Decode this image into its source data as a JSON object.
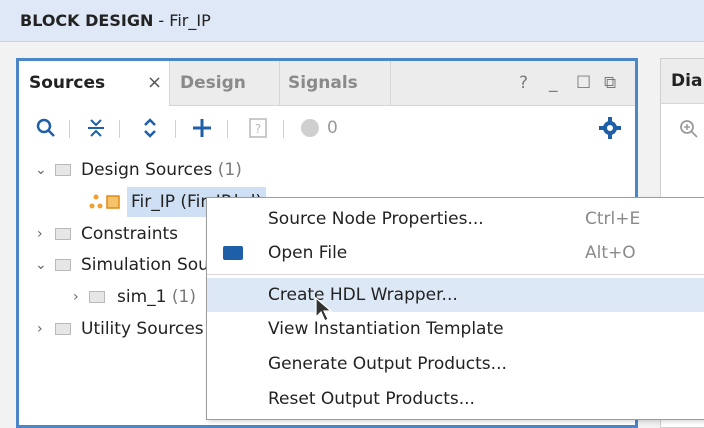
{
  "title_bar": {
    "label": "BLOCK DESIGN",
    "sep": " - ",
    "name": "Fir_IP"
  },
  "sources": {
    "tabs": [
      "Sources",
      "Design",
      "Signals"
    ],
    "close": "×",
    "controls": [
      "?",
      "_",
      "☐",
      "⧉"
    ],
    "toolbar": {
      "count": "0"
    },
    "tree": {
      "design_sources": {
        "label": "Design Sources",
        "count": "(1)"
      },
      "fir_ip": {
        "label": "Fir_IP (Fir_IP.bd)"
      },
      "constraints": {
        "label": "Constraints"
      },
      "simulation_sources": {
        "label": "Simulation Sources"
      },
      "sim_1": {
        "label": "sim_1",
        "count": "(1)"
      },
      "utility_sources": {
        "label": "Utility Sources"
      }
    }
  },
  "diagram": {
    "tab_label": "Dia"
  },
  "context_menu": {
    "items": [
      {
        "label": "Source Node Properties...",
        "shortcut": "Ctrl+E"
      },
      {
        "label": "Open File",
        "shortcut": "Alt+O"
      },
      {
        "label": "Create HDL Wrapper..."
      },
      {
        "label": "View Instantiation Template"
      },
      {
        "label": "Generate Output Products..."
      },
      {
        "label": "Reset Output Products..."
      }
    ]
  }
}
